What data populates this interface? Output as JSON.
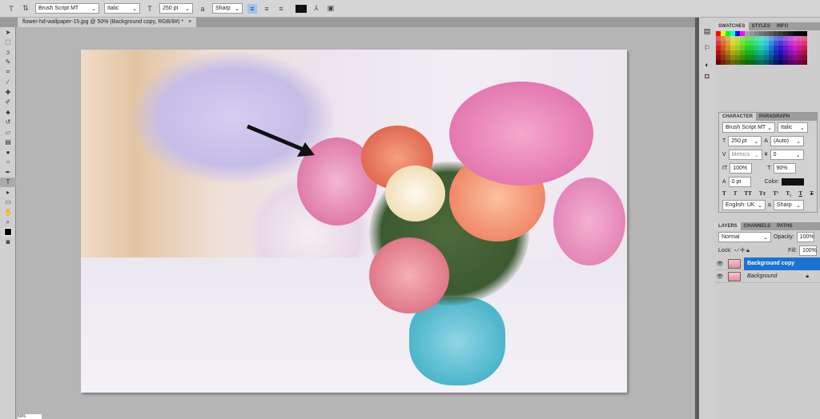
{
  "options": {
    "font_family": "Brush Script MT",
    "font_style": "Italic",
    "font_size": "250 pt",
    "antialias": "Sharp",
    "text_color": "#111111"
  },
  "document_tab": {
    "title": "flower-hd-wallpaper-15.jpg @ 50% (Background copy, RGB/8#) *",
    "close": "×"
  },
  "swatches_panel": {
    "tabs": [
      "SWATCHES",
      "STYLES",
      "INFO"
    ]
  },
  "character_panel": {
    "tabs": [
      "CHARACTER",
      "PARAGRAPH"
    ],
    "font_family": "Brush Script MT",
    "font_style": "Italic",
    "size": "250 pt",
    "leading": "(Auto)",
    "kerning": "Metrics",
    "tracking": "0",
    "vscale": "100%",
    "hscale": "90%",
    "baseline": "0 pt",
    "color_label": "Color:",
    "language": "English: UK",
    "antialias": "Sharp",
    "style_buttons": [
      "T",
      "T",
      "TT",
      "Tт",
      "T¹",
      "T₁",
      "T",
      "T"
    ]
  },
  "layers_panel": {
    "tabs": [
      "LAYERS",
      "CHANNELS",
      "PATHS"
    ],
    "blend_mode": "Normal",
    "opacity_label": "Opacity:",
    "opacity": "100%",
    "lock_label": "Lock:",
    "fill_label": "Fill:",
    "fill": "100%",
    "layers": [
      {
        "name": "Background copy",
        "selected": true
      },
      {
        "name": "Background",
        "selected": false
      }
    ]
  },
  "status": {
    "zoom": "50%"
  }
}
